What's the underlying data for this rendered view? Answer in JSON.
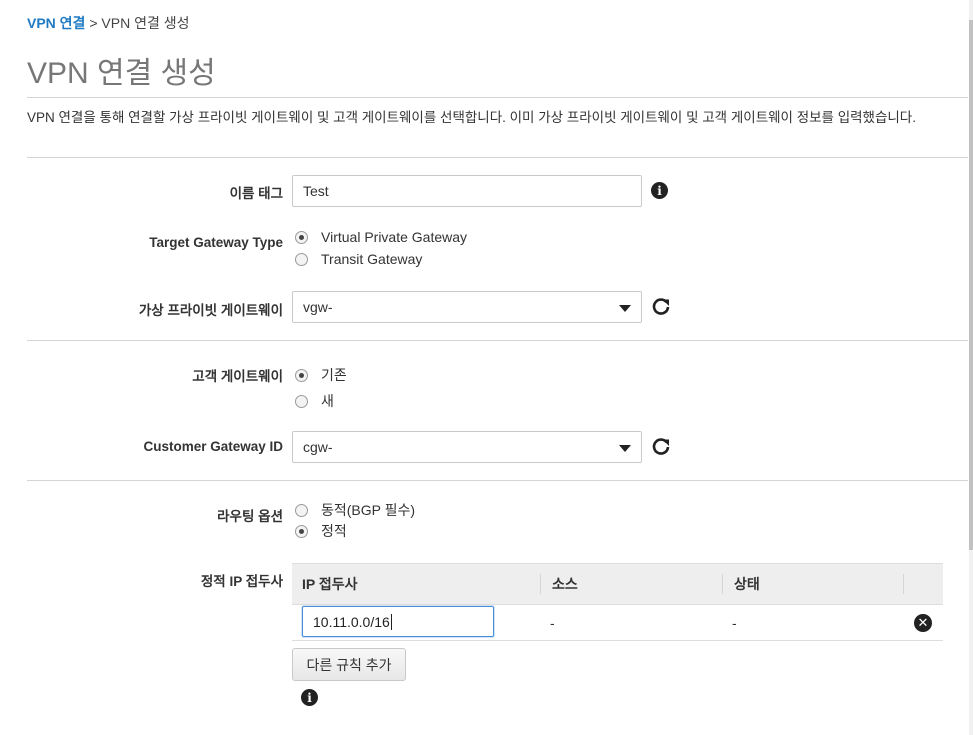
{
  "breadcrumb": {
    "parent": "VPN 연결",
    "separator": ">",
    "current": "VPN 연결 생성"
  },
  "page_title": "VPN 연결 생성",
  "description": "VPN 연결을 통해 연결할 가상 프라이빗 게이트웨이 및 고객 게이트웨이를 선택합니다. 이미 가상 프라이빗 게이트웨이 및 고객 게이트웨이 정보를 입력했습니다.",
  "name_tag": {
    "label": "이름 태그",
    "value": "Test"
  },
  "target_gateway_type": {
    "label": "Target Gateway Type",
    "options": [
      {
        "label": "Virtual Private Gateway",
        "checked": true
      },
      {
        "label": "Transit Gateway",
        "checked": false
      }
    ]
  },
  "virtual_private_gateway": {
    "label": "가상 프라이빗 게이트웨이",
    "value": "vgw-"
  },
  "customer_gateway": {
    "label": "고객 게이트웨이",
    "options": [
      {
        "label": "기존",
        "checked": true
      },
      {
        "label": "새",
        "checked": false
      }
    ]
  },
  "customer_gateway_id": {
    "label": "Customer Gateway ID",
    "value": "cgw-"
  },
  "routing_options": {
    "label": "라우팅 옵션",
    "options": [
      {
        "label": "동적(BGP 필수)",
        "checked": false
      },
      {
        "label": "정적",
        "checked": true
      }
    ]
  },
  "static_ip_prefixes": {
    "label": "정적 IP 접두사",
    "columns": [
      "IP 접두사",
      "소스",
      "상태"
    ],
    "rows": [
      {
        "prefix": "10.11.0.0/16",
        "source": "-",
        "status": "-"
      }
    ],
    "add_button": "다른 규칙 추가"
  },
  "icons": {
    "info": "info-icon",
    "refresh": "refresh-icon",
    "remove": "remove-icon",
    "dropdown": "chevron-down-icon"
  },
  "colors": {
    "link": "#1f7ac4",
    "title": "#777777",
    "table_header": "#eeeeee",
    "focus_border": "#4a90d9"
  }
}
